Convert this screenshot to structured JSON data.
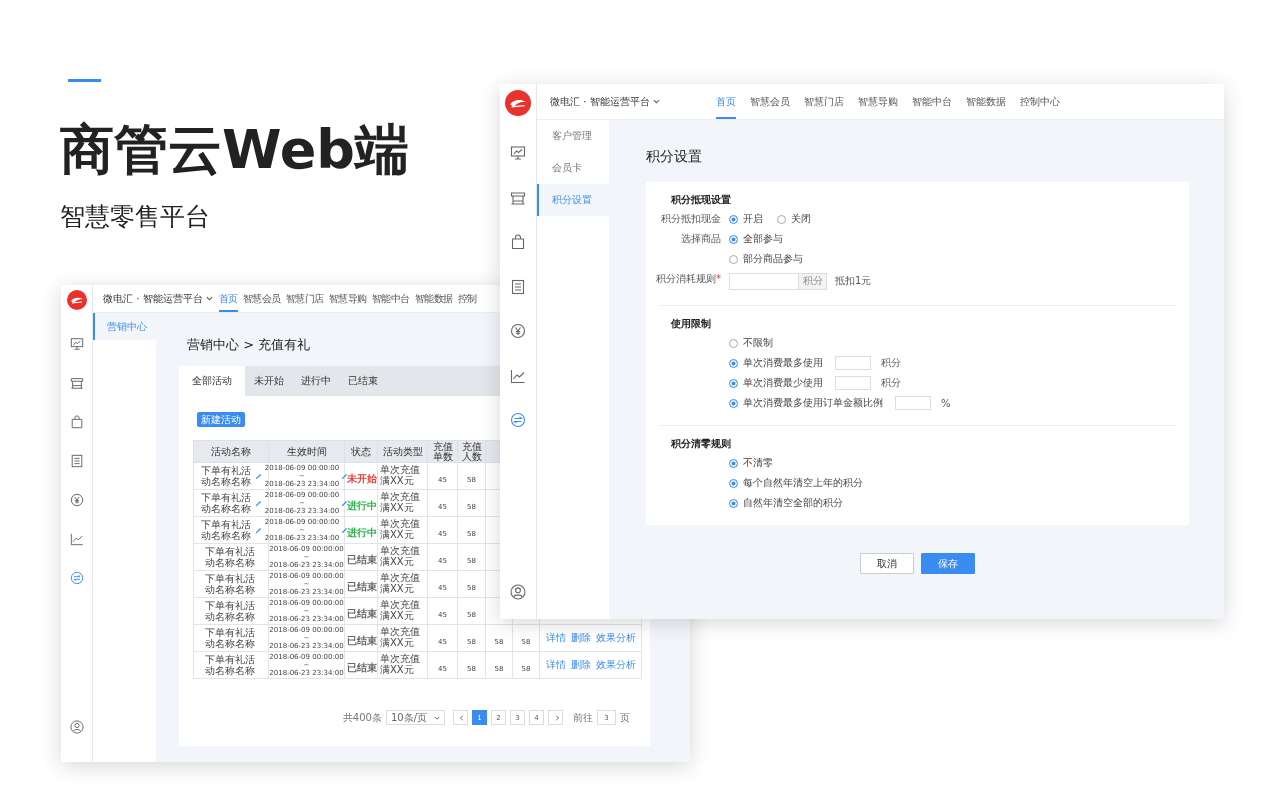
{
  "hero": {
    "title": "商管云Web端",
    "subtitle": "智慧零售平台"
  },
  "left_window": {
    "brand": "微电汇 · 智能运营平台",
    "nav": [
      {
        "label": "首页",
        "selected": true
      },
      {
        "label": "智慧会员",
        "selected": false
      },
      {
        "label": "智慧门店",
        "selected": false
      },
      {
        "label": "智慧导购",
        "selected": false
      },
      {
        "label": "智能中台",
        "selected": false
      },
      {
        "label": "智能数据",
        "selected": false
      },
      {
        "label": "控制",
        "selected": false
      }
    ],
    "rail": [
      {
        "kind": "board",
        "selected": false
      },
      {
        "kind": "store",
        "selected": false
      },
      {
        "kind": "bag",
        "selected": false
      },
      {
        "kind": "document",
        "selected": false
      },
      {
        "kind": "yen",
        "selected": false
      },
      {
        "kind": "chart",
        "selected": false
      },
      {
        "kind": "exchange",
        "selected": true
      }
    ],
    "sidebar": [
      {
        "label": "营销中心",
        "selected": true
      }
    ],
    "breadcrumb": "营销中心 > 充值有礼",
    "tabs": [
      {
        "label": "全部活动",
        "selected": true
      },
      {
        "label": "未开始",
        "selected": false
      },
      {
        "label": "进行中",
        "selected": false
      },
      {
        "label": "已结束",
        "selected": false
      }
    ],
    "new_button": "新建活动",
    "table": {
      "columns": [
        "活动名称",
        "生效时间",
        "状态",
        "活动类型",
        "充值单数",
        "充值人数"
      ],
      "rows": [
        {
          "name": "下单有礼活动名称名称",
          "editable": true,
          "start": "2018-06-09 00:00:00",
          "sep": "~",
          "end": "2018-06-23 23:34:00",
          "status": "未开始",
          "color": "#e8403a",
          "type": "单次充值满XX元",
          "values": [
            "45",
            "58"
          ]
        },
        {
          "name": "下单有礼活动名称名称",
          "editable": true,
          "start": "2018-06-09 00:00:00",
          "sep": "~",
          "end": "2018-06-23 23:34:00",
          "status": "进行中",
          "color": "#2db64a",
          "type": "单次充值满XX元",
          "values": [
            "45",
            "58"
          ]
        },
        {
          "name": "下单有礼活动名称名称",
          "editable": true,
          "start": "2018-06-09 00:00:00",
          "sep": "~",
          "end": "2018-06-23 23:34:00",
          "status": "进行中",
          "color": "#2db64a",
          "type": "单次充值满XX元",
          "values": [
            "45",
            "58"
          ]
        },
        {
          "name": "下单有礼活动名称名称",
          "editable": false,
          "start": "2018-06-09 00:00:00",
          "sep": "~",
          "end": "2018-06-23 23:34:00",
          "status": "已结束",
          "color": "#666666",
          "type": "单次充值满XX元",
          "values": [
            "45",
            "58"
          ]
        },
        {
          "name": "下单有礼活动名称名称",
          "editable": false,
          "start": "2018-06-09 00:00:00",
          "sep": "~",
          "end": "2018-06-23 23:34:00",
          "status": "已结束",
          "color": "#666666",
          "type": "单次充值满XX元",
          "values": [
            "45",
            "58"
          ]
        },
        {
          "name": "下单有礼活动名称名称",
          "editable": false,
          "start": "2018-06-09 00:00:00",
          "sep": "~",
          "end": "2018-06-23 23:34:00",
          "status": "已结束",
          "color": "#666666",
          "type": "单次充值满XX元",
          "values": [
            "45",
            "58"
          ]
        },
        {
          "name": "下单有礼活动名称名称",
          "editable": false,
          "start": "2018-06-09 00:00:00",
          "sep": "~",
          "end": "2018-06-23 23:34:00",
          "status": "已结束",
          "color": "#666666",
          "type": "单次充值满XX元",
          "values": [
            "45",
            "58",
            "58",
            "58"
          ],
          "actions": [
            "详情",
            "删除",
            "效果分析"
          ]
        },
        {
          "name": "下单有礼活动名称名称",
          "editable": false,
          "start": "2018-06-09 00:00:00",
          "sep": "~",
          "end": "2018-06-23 23:34:00",
          "status": "已结束",
          "color": "#666666",
          "type": "单次充值满XX元",
          "values": [
            "45",
            "58",
            "58",
            "58"
          ],
          "actions": [
            "详情",
            "删除",
            "效果分析"
          ]
        }
      ]
    },
    "pagination": {
      "total": "共400条",
      "page_size": "10条/页",
      "pages": [
        {
          "label": "1",
          "selected": true
        },
        {
          "label": "2",
          "selected": false
        },
        {
          "label": "3",
          "selected": false
        },
        {
          "label": "4",
          "selected": false
        }
      ],
      "goto_label": "前往",
      "goto_value": "3",
      "goto_suffix": "页"
    }
  },
  "right_window": {
    "brand": "微电汇 · 智能运营平台",
    "nav": [
      {
        "label": "首页",
        "selected": true
      },
      {
        "label": "智慧会员",
        "selected": false
      },
      {
        "label": "智慧门店",
        "selected": false
      },
      {
        "label": "智慧导购",
        "selected": false
      },
      {
        "label": "智能中台",
        "selected": false
      },
      {
        "label": "智能数据",
        "selected": false
      },
      {
        "label": "控制中心",
        "selected": false
      }
    ],
    "rail": [
      {
        "kind": "board",
        "selected": false
      },
      {
        "kind": "store",
        "selected": false
      },
      {
        "kind": "bag",
        "selected": false
      },
      {
        "kind": "document",
        "selected": false
      },
      {
        "kind": "yen",
        "selected": false
      },
      {
        "kind": "chart",
        "selected": false
      },
      {
        "kind": "exchange",
        "selected": true
      }
    ],
    "sidebar": [
      {
        "label": "客户管理",
        "selected": false
      },
      {
        "label": "会员卡",
        "selected": false
      },
      {
        "label": "积分设置",
        "selected": true
      }
    ],
    "title": "积分设置",
    "sections": [
      {
        "heading": "积分抵现设置",
        "rows": [
          {
            "kind": "radio_group",
            "label": "积分抵扣现金",
            "options": [
              {
                "label": "开启",
                "selected": true
              },
              {
                "label": "关闭",
                "selected": false
              }
            ]
          },
          {
            "kind": "radio_list",
            "label": "选择商品",
            "options": [
              {
                "label": "全部参与",
                "selected": true
              },
              {
                "label": "部分商品参与",
                "selected": false
              }
            ]
          },
          {
            "kind": "input",
            "label": "积分消耗规则",
            "required_mark": "*",
            "addon": "积分",
            "suffix": "抵扣1元"
          }
        ]
      },
      {
        "heading": "使用限制",
        "rows": [
          {
            "kind": "radio_list",
            "options": [
              {
                "label": "不限制",
                "selected": false
              },
              {
                "label": "单次消费最多使用",
                "selected": true,
                "unit": "积分"
              },
              {
                "label": "单次消费最少使用",
                "selected": true,
                "unit": "积分"
              },
              {
                "label": "单次消费最多使用订单金额比例",
                "selected": true,
                "unit": "%"
              }
            ]
          }
        ]
      },
      {
        "heading": "积分清零规则",
        "rows": [
          {
            "kind": "radio_list",
            "options": [
              {
                "label": "不清零",
                "selected": true
              },
              {
                "label": "每个自然年清空上年的积分",
                "selected": true
              },
              {
                "label": "自然年清空全部的积分",
                "selected": true
              }
            ]
          }
        ]
      }
    ],
    "buttons": [
      {
        "label": "取消",
        "kind": "secondary"
      },
      {
        "label": "保存",
        "kind": "primary"
      }
    ]
  }
}
